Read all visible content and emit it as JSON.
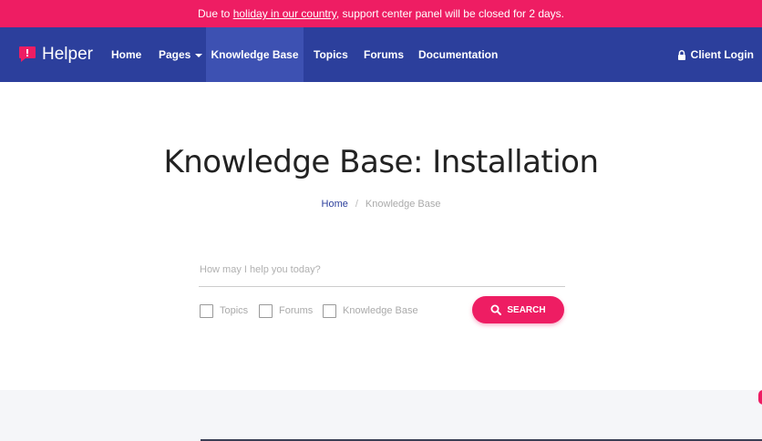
{
  "announcement": {
    "prefix": "Due to ",
    "link": "holiday in our country",
    "suffix": ", support center panel will be closed for 2 days."
  },
  "brand": {
    "name": "Helper",
    "icon": "speech-bubble-icon"
  },
  "nav": {
    "home": "Home",
    "pages": "Pages",
    "knowledge_base": "Knowledge Base",
    "topics": "Topics",
    "forums": "Forums",
    "documentation": "Documentation",
    "client_login": "Client Login"
  },
  "hero": {
    "title": "Knowledge Base: Installation",
    "breadcrumb": {
      "home": "Home",
      "separator": "/",
      "current": "Knowledge Base"
    }
  },
  "search": {
    "placeholder": "How may I help you today?",
    "value": "",
    "filters": [
      "Topics",
      "Forums",
      "Knowledge Base"
    ],
    "button": "SEARCH"
  },
  "colors": {
    "accent": "#ee1d63",
    "nav_bg": "#2c3f9c",
    "nav_active": "#3d51b2"
  }
}
